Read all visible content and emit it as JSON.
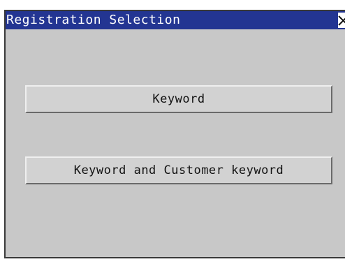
{
  "window": {
    "title": "Registration Selection",
    "close_icon": "close-icon",
    "colors": {
      "titlebar": "#233592",
      "title_text": "#ffffff",
      "background": "#c8c8c8",
      "button_face": "#d2d2d2"
    }
  },
  "buttons": {
    "keyword_label": "Keyword",
    "keyword_and_customer_label": "Keyword and Customer keyword"
  }
}
